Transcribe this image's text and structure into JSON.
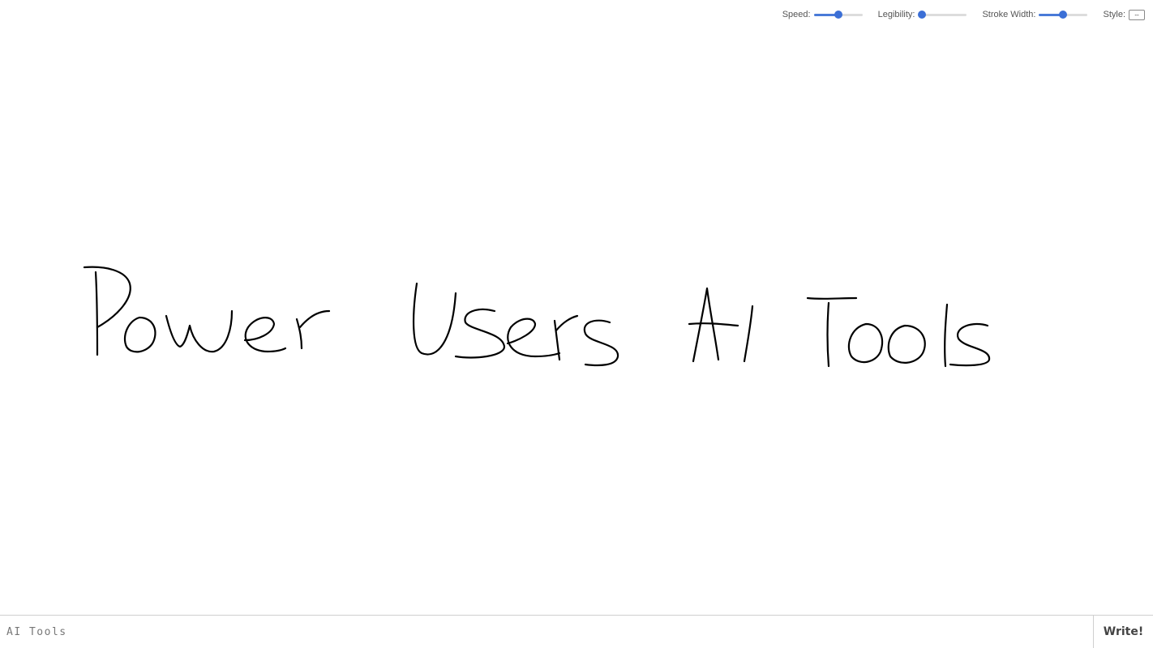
{
  "controls": {
    "speed": {
      "label": "Speed:",
      "value": 0.5
    },
    "legibility": {
      "label": "Legibility:",
      "value": 0.0
    },
    "stroke_width": {
      "label": "Stroke Width:",
      "value": 0.5
    },
    "style": {
      "label": "Style:",
      "selected": "--"
    }
  },
  "canvas": {
    "rendered_text": "Power Users AI Tools"
  },
  "input": {
    "value": "AI Tools"
  },
  "write_button": {
    "label": "Write!"
  },
  "colors": {
    "accent": "#3b6fd6",
    "ink": "#000000"
  }
}
